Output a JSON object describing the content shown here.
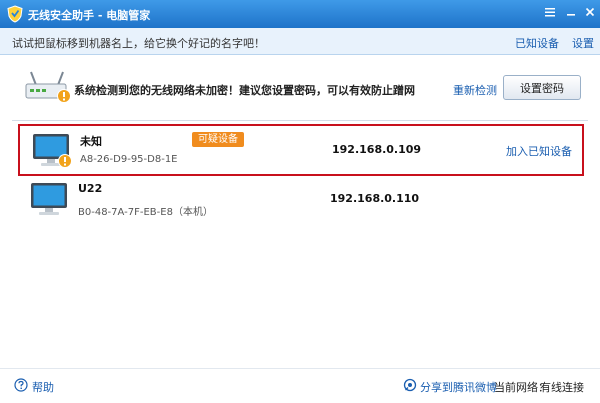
{
  "window": {
    "title": "无线安全助手 - 电脑管家",
    "controls": [
      "menu-icon",
      "minimize-icon",
      "close-icon"
    ]
  },
  "hint_bar": {
    "text": "试试把鼠标移到机器名上，给它换个好记的名字吧！",
    "known_devices_link": "已知设备",
    "settings_link": "设置"
  },
  "warning": {
    "icon": "router-warning-icon",
    "text": "系统检测到您的无线网络未加密！建议您设置密码，可以有效防止蹭网",
    "recheck_link": "重新检测",
    "set_password_button": "设置密码"
  },
  "devices": [
    {
      "icon": "computer-warning-icon",
      "name": "未知",
      "badge": "可疑设备",
      "mac": "A8-26-D9-95-D8-1E",
      "ip": "192.168.0.109",
      "action": "加入已知设备"
    },
    {
      "icon": "computer-icon",
      "name": "U22",
      "mac": "B0-48-7A-7F-EB-E8（本机）",
      "ip": "192.168.0.110"
    }
  ],
  "footer": {
    "help": "帮助",
    "share": "分享到腾讯微博",
    "network_label": "当前网络：",
    "network_value": "有线连接"
  },
  "colors": {
    "titlebar": "#2a84d8",
    "link": "#1a5eb0",
    "suspicious_badge": "#f08c1e",
    "highlight_border": "#c8101c"
  }
}
